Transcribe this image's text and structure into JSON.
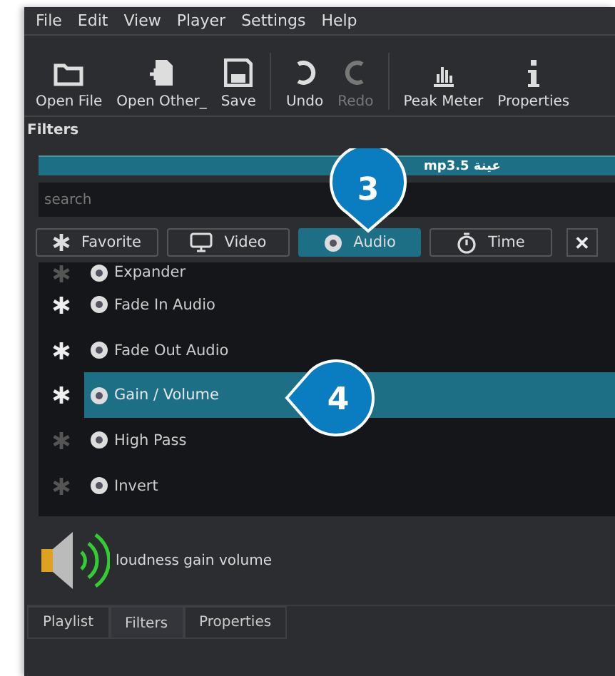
{
  "menu": [
    {
      "label": "File"
    },
    {
      "label": "Edit"
    },
    {
      "label": "View"
    },
    {
      "label": "Player"
    },
    {
      "label": "Settings"
    },
    {
      "label": "Help"
    }
  ],
  "toolbar": [
    {
      "kind": "folder",
      "label": "Open File",
      "disabled": false
    },
    {
      "kind": "new",
      "label": "Open Other_",
      "disabled": false
    },
    {
      "kind": "save",
      "label": "Save",
      "disabled": false
    },
    {
      "kind": "undo",
      "label": "Undo",
      "disabled": false
    },
    {
      "kind": "redo",
      "label": "Redo",
      "disabled": true
    },
    {
      "kind": "meter",
      "label": "Peak Meter",
      "disabled": false
    },
    {
      "kind": "info",
      "label": "Properties",
      "disabled": false
    }
  ],
  "panel": {
    "title": "Filters",
    "clip": "mp3.5 عينة",
    "search": {
      "placeholder": "search"
    }
  },
  "filter_tabs": [
    {
      "kind": "star",
      "label": "Favorite",
      "selected": false
    },
    {
      "kind": "monitor",
      "label": "Video",
      "selected": false
    },
    {
      "kind": "disc",
      "label": "Audio",
      "selected": true
    },
    {
      "kind": "timer",
      "label": "Time",
      "selected": false
    }
  ],
  "close": "✕",
  "filters": [
    {
      "label": "Expander",
      "favorite": false,
      "selected": false
    },
    {
      "label": "Fade In Audio",
      "favorite": true,
      "selected": false
    },
    {
      "label": "Fade Out Audio",
      "favorite": true,
      "selected": false
    },
    {
      "label": "Gain / Volume",
      "favorite": true,
      "selected": true
    },
    {
      "label": "High Pass",
      "favorite": false,
      "selected": false
    },
    {
      "label": "Invert",
      "favorite": false,
      "selected": false
    }
  ],
  "description": "loudness gain volume",
  "bottom_tabs": [
    {
      "label": "Playlist",
      "selected": false
    },
    {
      "label": "Filters",
      "selected": true
    },
    {
      "label": "Properties",
      "selected": false
    }
  ],
  "callouts": [
    {
      "label": "3",
      "kind": "down"
    },
    {
      "label": "4",
      "kind": "left"
    }
  ]
}
